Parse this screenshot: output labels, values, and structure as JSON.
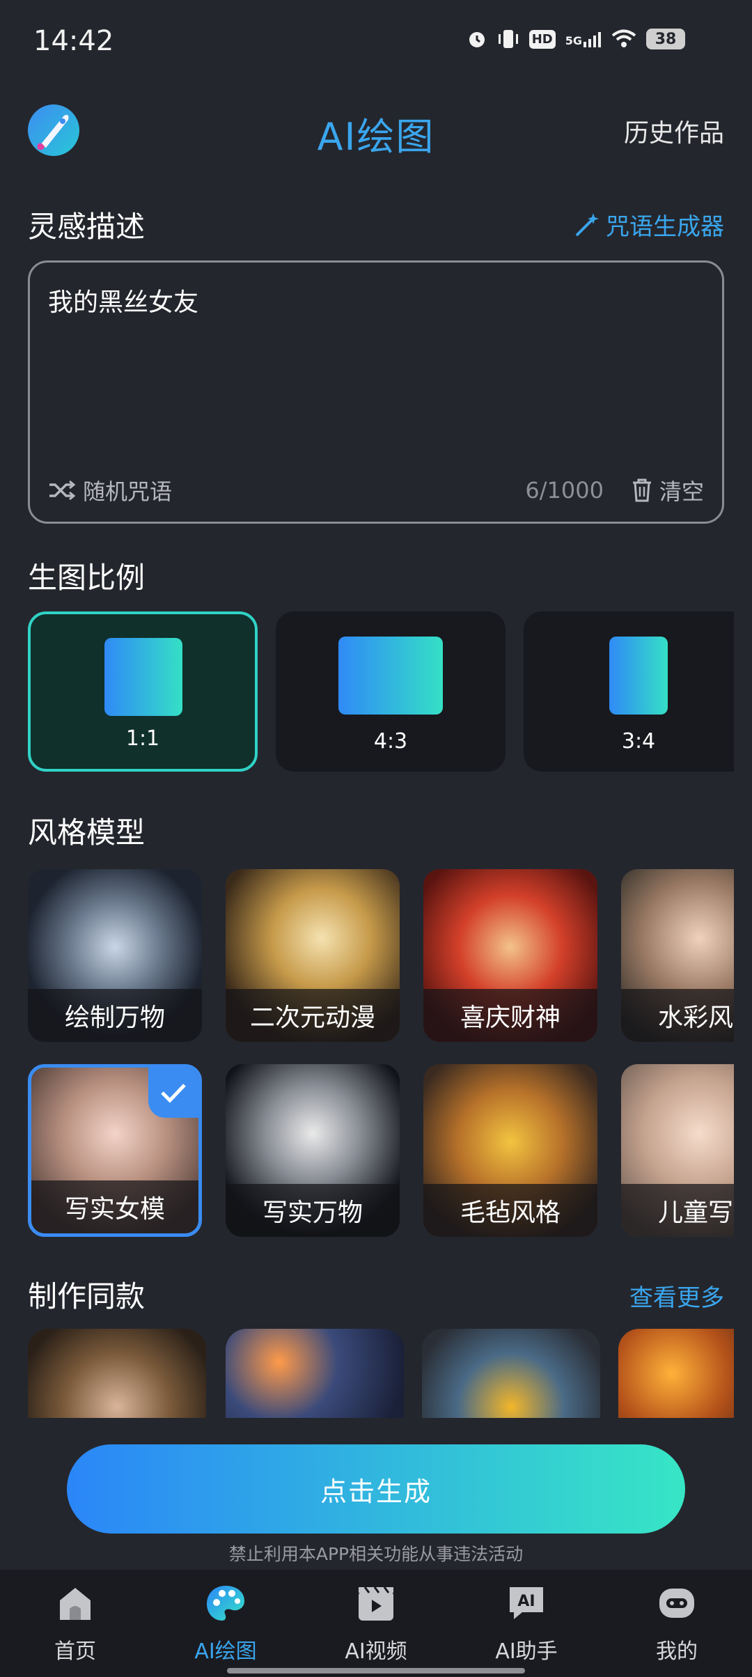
{
  "status_bar": {
    "time": "14:42",
    "network": "5G",
    "hd": "HD",
    "battery": "38"
  },
  "header": {
    "title": "AI绘图",
    "history_link": "历史作品"
  },
  "inspiration": {
    "title": "灵感描述",
    "spell_generator": "咒语生成器",
    "prompt_text": "我的黑丝女友",
    "random_spell": "随机咒语",
    "char_count": "6/1000",
    "clear": "清空"
  },
  "ratio": {
    "title": "生图比例",
    "options": [
      {
        "label": "1:1",
        "selected": true
      },
      {
        "label": "4:3",
        "selected": false
      },
      {
        "label": "3:4",
        "selected": false
      }
    ]
  },
  "styles": {
    "title": "风格模型",
    "items": [
      {
        "label": "绘制万物",
        "selected": false
      },
      {
        "label": "二次元动漫",
        "selected": false
      },
      {
        "label": "喜庆财神",
        "selected": false
      },
      {
        "label": "水彩风格",
        "selected": false
      },
      {
        "label": "写实女模",
        "selected": true
      },
      {
        "label": "写实万物",
        "selected": false
      },
      {
        "label": "毛毡风格",
        "selected": false
      },
      {
        "label": "儿童写真",
        "selected": false
      }
    ]
  },
  "same_style": {
    "title": "制作同款",
    "more": "查看更多"
  },
  "generate": {
    "label": "点击生成",
    "disclaimer": "禁止利用本APP相关功能从事违法活动"
  },
  "bottom_nav": [
    {
      "label": "首页",
      "icon": "home-icon",
      "active": false
    },
    {
      "label": "AI绘图",
      "icon": "palette-icon",
      "active": true
    },
    {
      "label": "AI视频",
      "icon": "video-icon",
      "active": false
    },
    {
      "label": "AI助手",
      "icon": "assistant-icon",
      "active": false
    },
    {
      "label": "我的",
      "icon": "robot-icon",
      "active": false
    }
  ],
  "colors": {
    "accent": "#3aa6ee",
    "gradient_start": "#2b86f8",
    "gradient_end": "#37e6c5",
    "background": "#24262d"
  }
}
